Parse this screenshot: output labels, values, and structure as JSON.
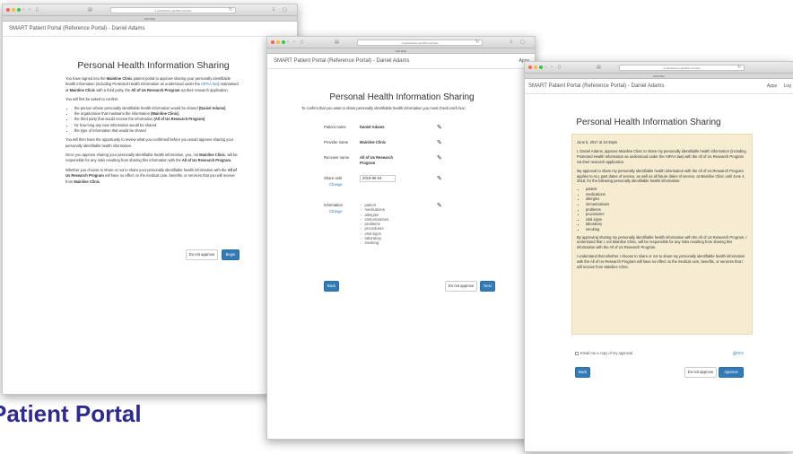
{
  "browser": {
    "url": "ri.portal.demo.gsmfhir.com/ces",
    "tab": "Add Filter"
  },
  "app": {
    "brand": "SMART Patient Portal (Reference Portal) - Daniel Adams",
    "nav": [
      "Apps",
      "Log"
    ]
  },
  "screen1": {
    "title": "Personal Health Information Sharing",
    "p1": {
      "a": "You have signed into the ",
      "clinic": "Mainline Clinic",
      "b": " patient portal to approve sharing your personally identifiable health information (including Protected Health Information as understood under the ",
      "hipaa": "HIPAA law",
      "c": ") maintained at ",
      "clinic2": "Mainline Clinic",
      "d": " with a third party, the ",
      "program": "All of Us Research Program",
      "e": " via their research application."
    },
    "p2": "You will first be asked to confirm:",
    "bullets": [
      {
        "text": "the person whose personally identifiable health information would be shared ",
        "bold": "(Daniel Adams)"
      },
      {
        "text": "the organization that maintains the information ",
        "bold": "(Mainline Clinic)"
      },
      {
        "text": "the third party that would receive the information ",
        "bold": "(All of Us Research Program)"
      },
      {
        "text": "for how long any new information would be shared",
        "bold": ""
      },
      {
        "text": "the type of information that would be shared",
        "bold": ""
      }
    ],
    "p3": "You will then have the opportunity to review what you confirmed before you would approve sharing your personally identifiable health information.",
    "p4": {
      "a": "Once you approve sharing your personally identifiable health information, you, not ",
      "clinic": "Mainline Clinic",
      "b": ", will be responsible for any risks resulting from sharing this information with the ",
      "program": "All of Us Research Program",
      "c": "."
    },
    "p5": {
      "a": "Whether you choose to share or not to share your personally identifiable health information with the ",
      "program": "All of Us Research Program",
      "b": " will have no effect on the medical care, benefits, or services that you will receive from ",
      "clinic": "Mainline Clinic",
      "c": "."
    },
    "btn_decline": "Do not approve",
    "btn_begin": "Begin"
  },
  "screen2": {
    "title": "Personal Health Information Sharing",
    "intro": "To confirm that you want to share personally identifiable health information you must check each box:",
    "rows": [
      {
        "label": "Patient name",
        "value": "Daniel Adams"
      },
      {
        "label": "Provider name",
        "value": "Mainline Clinic"
      },
      {
        "label": "Receiver name",
        "value": "All of Us Research Program"
      }
    ],
    "share_label": "Share until",
    "share_change": "Change",
    "share_date": "2018-06-04",
    "info_label": "Information",
    "info_change": "Change",
    "info_items": [
      "patient",
      "medications",
      "allergies",
      "immunizations",
      "problems",
      "procedures",
      "vital signs",
      "laboratory",
      "smoking"
    ],
    "btn_back": "Back",
    "btn_decline": "Do not approve",
    "btn_next": "Next"
  },
  "screen3": {
    "title": "Personal Health Information Sharing",
    "date": "June 5, 2017 at 10:45pm",
    "p1": "I, Daniel Adams, approve Mainline Clinic to share my personally identifiable health information (including Protected Health Information as understood under the HIPAA law) with the All of Us Research Program via their research application.",
    "p2": "My approval to share my personally identifiable health information with the All of Us Research Program applies to ALL past dates of service, as well as all future dates of service, at Mainline Clinic until June 4, 2018, for the following personally identifiable health information:",
    "items": [
      "patient",
      "medications",
      "allergies",
      "immunizations",
      "problems",
      "procedures",
      "vital signs",
      "laboratory",
      "smoking"
    ],
    "p3": "By approving sharing my personally identifiable health information with the All of Us Research Program, I understand that I, not Mainline Clinic, will be responsible for any risks resulting from sharing this information with the All of Us Research Program.",
    "p4": "I understand that whether I choose to share or not to share my personally identifiable health information with the All of Us Research Program will have no effect on the medical care, benefits, or services that I will receive from Mainline Clinic.",
    "email_label": "Email me a copy of my approval",
    "print": "Print",
    "btn_back": "Back",
    "btn_decline": "Do not approve",
    "btn_approve": "Approve"
  },
  "caption": "Patient Portal",
  "colors": {
    "primary": "#337ab7",
    "notice_bg": "#f5ecd2",
    "caption": "#2f2b8a"
  }
}
